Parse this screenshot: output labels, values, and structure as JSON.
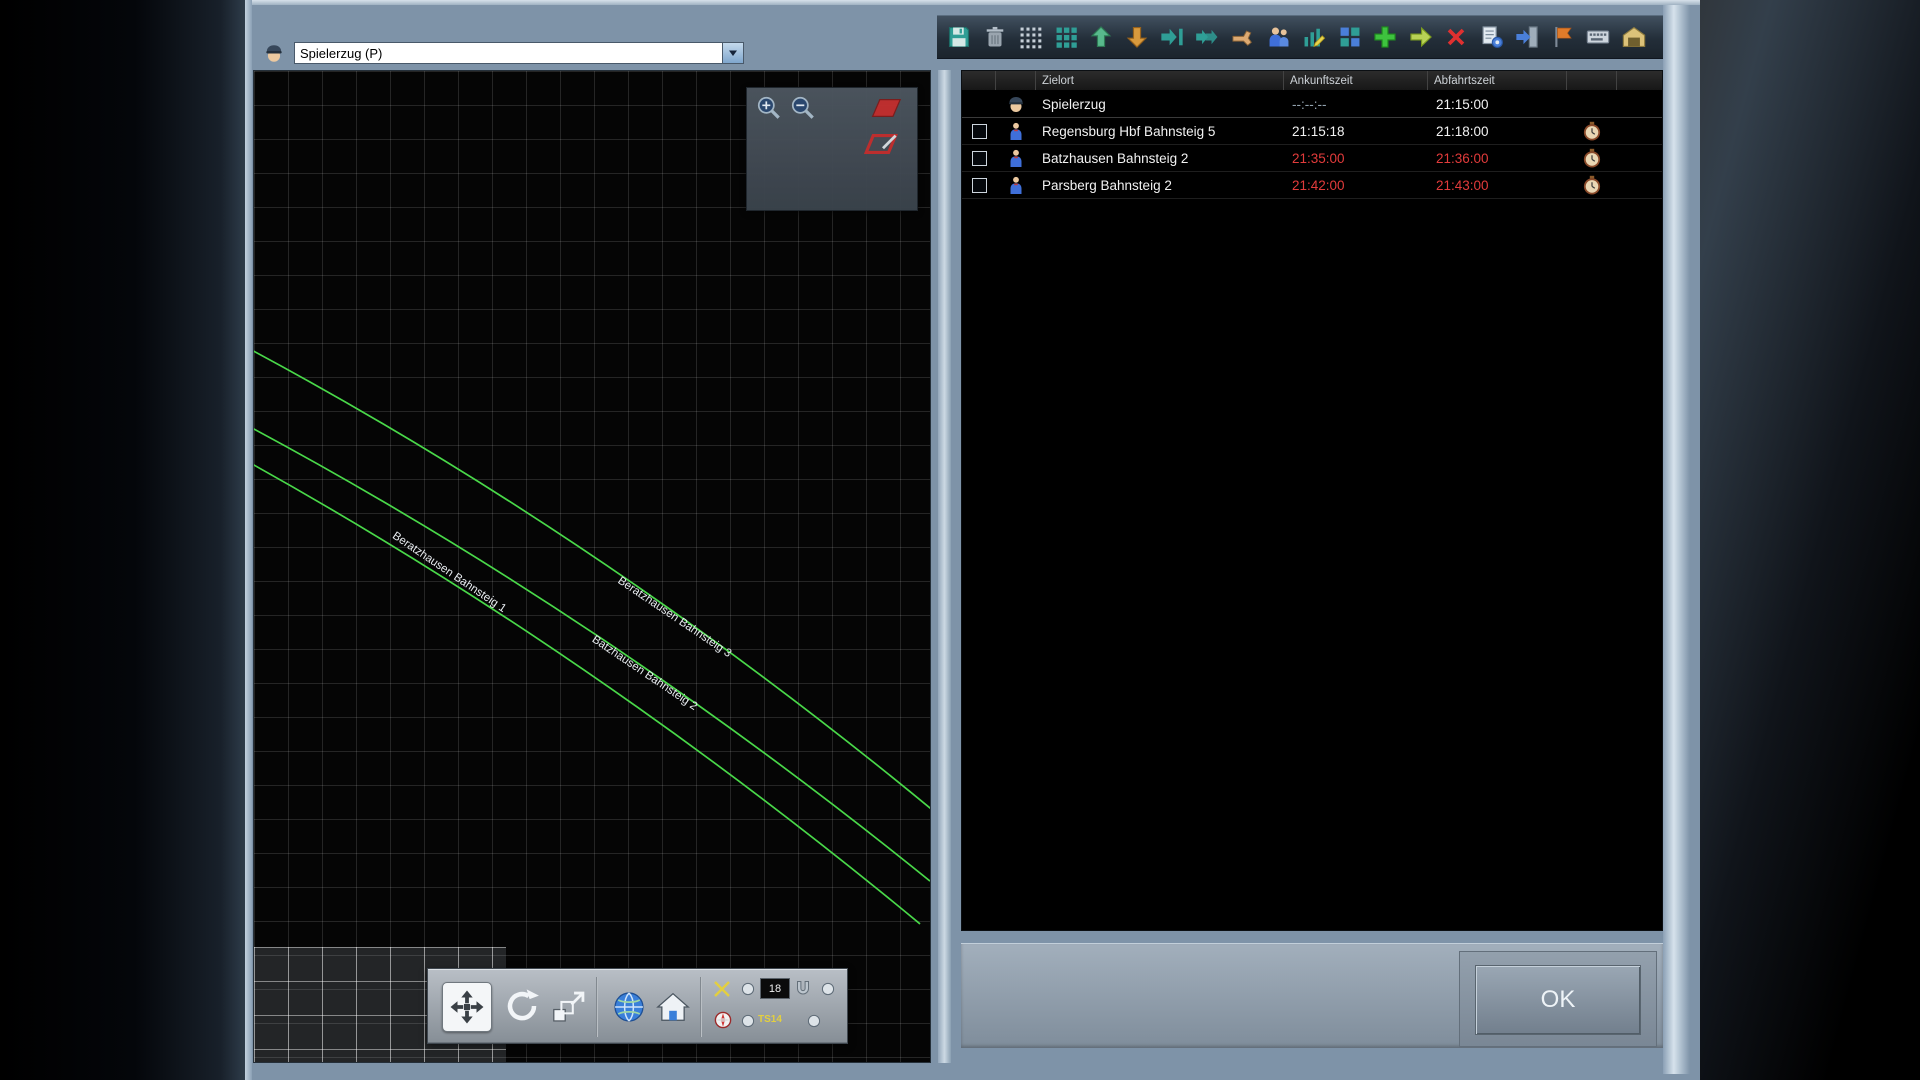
{
  "colors": {
    "track_green": "#49d849",
    "late_red": "#e23b3b",
    "time_normal": "#f2f2f2",
    "time_muted": "#93a3b0",
    "frame": "#7e93a8"
  },
  "map": {
    "train_selector": {
      "value": "Spielerzug (P)"
    },
    "track_labels": [
      {
        "text": "Beratzhausen Bahnsteig 1"
      },
      {
        "text": "Beratzhausen Bahnsteig 3"
      },
      {
        "text": "Batzhausen Bahnsteig 2"
      }
    ],
    "overlay_icons": [
      "zoom-in",
      "zoom-out",
      "red-shape",
      "red-shape-edit"
    ],
    "toolbar": {
      "icons": [
        "move",
        "rotate",
        "free-move",
        "globe",
        "home"
      ],
      "value_box": "18",
      "track_id": "TS14"
    }
  },
  "timetable": {
    "toolbar_icons": [
      "save",
      "delete",
      "grid-small",
      "grid-large",
      "move-up",
      "move-down",
      "insert-row",
      "append-row",
      "pick-hand",
      "passengers",
      "chart-edit",
      "grid-blue",
      "add-plus",
      "add-arrow",
      "remove-x",
      "form-gear",
      "door-enter",
      "flag",
      "keyboard",
      "depot"
    ],
    "header": {
      "zielort": "Zielort",
      "ankunftszeit": "Ankunftszeit",
      "abfahrtszeit": "Abfahrtszeit"
    },
    "rows": [
      {
        "kind": "train",
        "icon": "driver",
        "name": "Spielerzug",
        "arrival": "--:--:--",
        "departure": "21:15:00",
        "arrival_style": "muted",
        "departure_style": "normal",
        "has_checkbox": false,
        "has_clock": false
      },
      {
        "kind": "stop",
        "icon": "passenger",
        "name": "Regensburg Hbf Bahnsteig 5",
        "arrival": "21:15:18",
        "departure": "21:18:00",
        "arrival_style": "normal",
        "departure_style": "normal",
        "has_checkbox": true,
        "has_clock": true
      },
      {
        "kind": "stop",
        "icon": "passenger",
        "name": "Batzhausen Bahnsteig 2",
        "arrival": "21:35:00",
        "departure": "21:36:00",
        "arrival_style": "late",
        "departure_style": "late",
        "has_checkbox": true,
        "has_clock": true
      },
      {
        "kind": "stop",
        "icon": "passenger",
        "name": "Parsberg Bahnsteig 2",
        "arrival": "21:42:00",
        "departure": "21:43:00",
        "arrival_style": "late",
        "departure_style": "late",
        "has_checkbox": true,
        "has_clock": true
      }
    ],
    "footer": {
      "ok_label": "OK"
    }
  }
}
